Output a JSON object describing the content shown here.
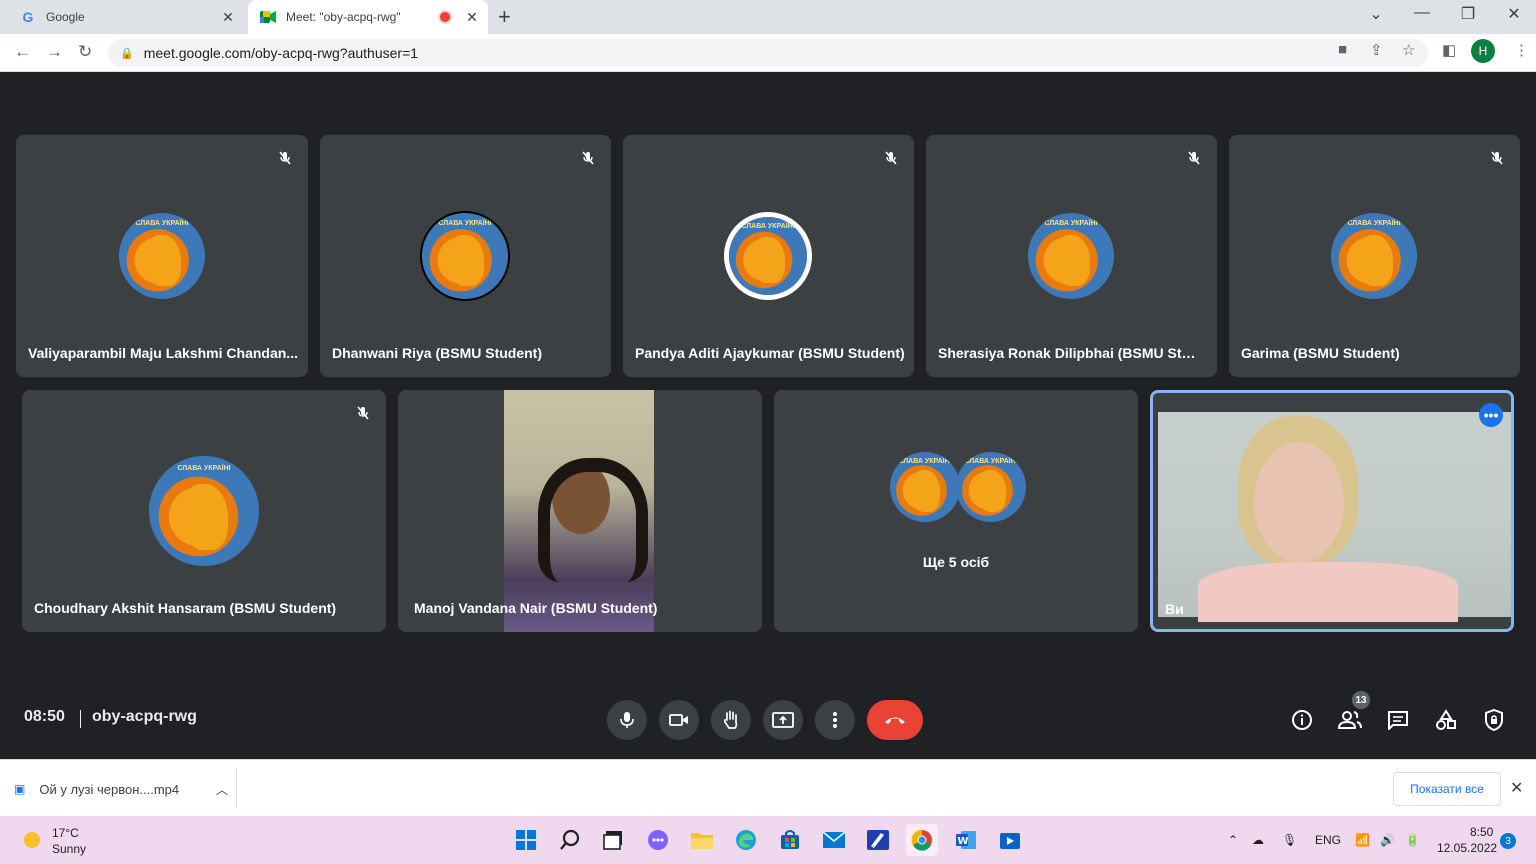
{
  "browser": {
    "tabs": [
      {
        "title": "Google",
        "icon": "google-icon"
      },
      {
        "title": "Meet: \"oby-acpq-rwg\"",
        "icon": "meet-icon",
        "recording": true
      }
    ],
    "url": "meet.google.com/oby-acpq-rwg?authuser=1",
    "profile_initial": "H"
  },
  "meet": {
    "participants_row1": [
      {
        "name": "Valiyaparambil Maju Lakshmi Chandan...",
        "muted": true
      },
      {
        "name": "Dhanwani Riya (BSMU Student)",
        "muted": true
      },
      {
        "name": "Pandya Aditi Ajaykumar (BSMU Student)",
        "muted": true
      },
      {
        "name": "Sherasiya Ronak Dilipbhai (BSMU Stud...",
        "muted": true
      },
      {
        "name": "Garima (BSMU Student)",
        "muted": true
      }
    ],
    "participants_row2": [
      {
        "name": "Choudhary Akshit Hansaram (BSMU Student)",
        "muted": true
      },
      {
        "name": "Manoj Vandana Nair (BSMU Student)",
        "muted": false
      },
      {
        "name": "Ще 5 осіб"
      },
      {
        "name": "Ви"
      }
    ],
    "avatar_caption": "СЛАВА УКРАЇНІ",
    "clock": "08:50",
    "meeting_code": "oby-acpq-rwg",
    "people_count": "13"
  },
  "downloads": {
    "file_name": "Ой у лузі червон....mp4",
    "show_all_label": "Показати все"
  },
  "taskbar": {
    "weather_temp": "17°C",
    "weather_desc": "Sunny",
    "language": "ENG",
    "time": "8:50",
    "date": "12.05.2022",
    "notifications": "3"
  },
  "colors": {
    "meet_bg": "#202124",
    "tile_bg": "#3c4043",
    "hangup": "#ea4335",
    "accent": "#1a73e8"
  }
}
